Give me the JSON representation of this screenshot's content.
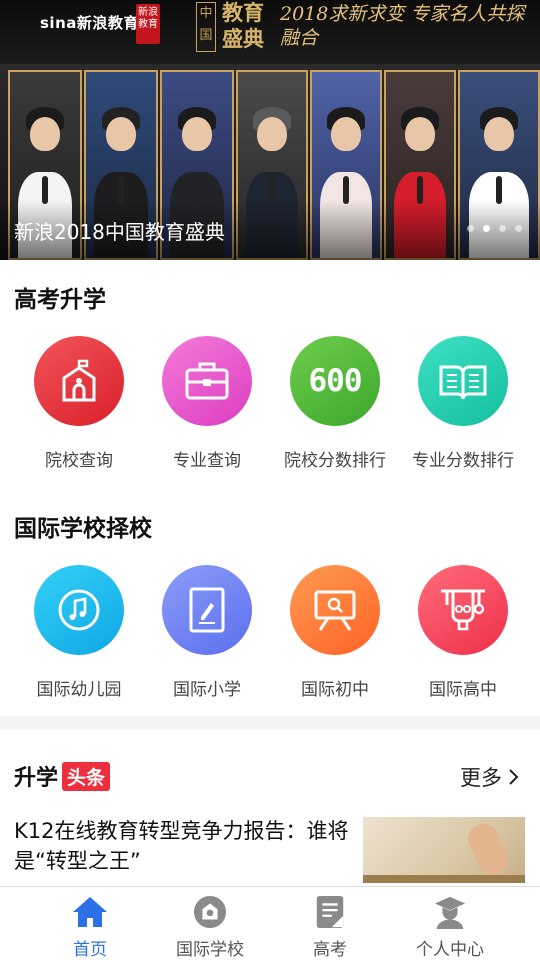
{
  "banner": {
    "brand_logo": "sina新浪教育",
    "seal_text": "新浪教育",
    "event_badge": "中国",
    "event_title": "教育盛典",
    "event_slogan": "2018求新求变 专家名人共探融合",
    "caption": "新浪2018中国教育盛典",
    "dot_count": 4,
    "active_dot": 1
  },
  "gaokao": {
    "title": "高考升学",
    "items": [
      {
        "label": "院校查询",
        "icon": "school-building-icon",
        "color": "#e8333c"
      },
      {
        "label": "专业查询",
        "icon": "briefcase-icon",
        "color": "#e84ecb"
      },
      {
        "label": "院校分数排行",
        "icon": "score-600-icon",
        "color": "#52b93a",
        "icon_text": "600"
      },
      {
        "label": "专业分数排行",
        "icon": "open-book-icon",
        "color": "#1fcfb0"
      }
    ]
  },
  "international": {
    "title": "国际学校择校",
    "items": [
      {
        "label": "国际幼儿园",
        "icon": "music-note-icon",
        "color": "#16b8ef"
      },
      {
        "label": "国际小学",
        "icon": "notebook-icon",
        "color": "#6f83f2"
      },
      {
        "label": "国际初中",
        "icon": "presentation-board-icon",
        "color": "#ff7a37"
      },
      {
        "label": "国际高中",
        "icon": "lab-flask-icon",
        "color": "#f5405c"
      }
    ]
  },
  "news": {
    "title_part1": "升学",
    "title_part2": "头条",
    "more_label": "更多",
    "articles": [
      {
        "title": "K12在线教育转型竞争力报告：谁将是“转型之王”"
      }
    ]
  },
  "tabbar": {
    "active_color": "#2c70e6",
    "tabs": [
      {
        "label": "首页",
        "icon": "home-icon",
        "active": true
      },
      {
        "label": "国际学校",
        "icon": "school-camera-icon",
        "active": false
      },
      {
        "label": "高考",
        "icon": "exam-paper-icon",
        "active": false
      },
      {
        "label": "个人中心",
        "icon": "graduate-user-icon",
        "active": false
      }
    ]
  }
}
